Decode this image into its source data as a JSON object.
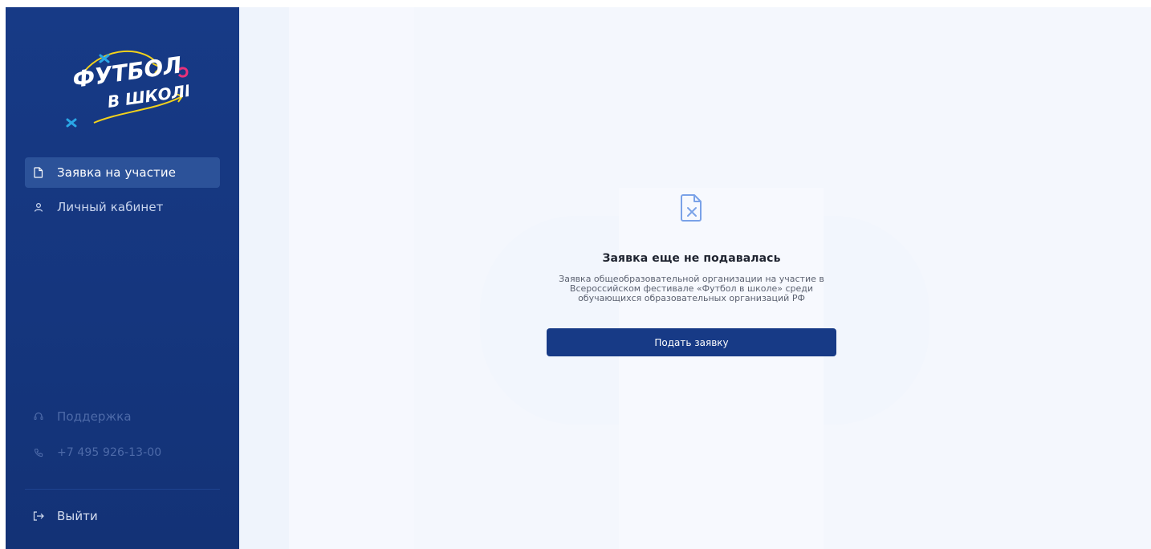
{
  "sidebar": {
    "logo_alt": "Футбол в школе",
    "nav": [
      {
        "label": "Заявка на участие",
        "icon": "document-icon",
        "active": true
      },
      {
        "label": "Личный кабинет",
        "icon": "user-icon",
        "active": false
      }
    ],
    "support_label": "Поддержка",
    "phone": "+7 495 926-13-00",
    "logout_label": "Выйти"
  },
  "empty_state": {
    "icon": "file-x-icon",
    "title": "Заявка еще не подавалась",
    "description": "Заявка общеобразовательной организации на участие в Всероссийском фестивале «Футбол в школе» среди обучающихся образовательных организаций РФ",
    "button_label": "Подать заявку"
  },
  "colors": {
    "sidebar_bg": "#173a86",
    "active_item_bg": "#2c5299",
    "main_bg": "#f4f7fd",
    "button_bg": "#173a86",
    "accent_yellow": "#f3d21b",
    "accent_pink": "#e8317a",
    "accent_cyan": "#2aa7e6"
  }
}
